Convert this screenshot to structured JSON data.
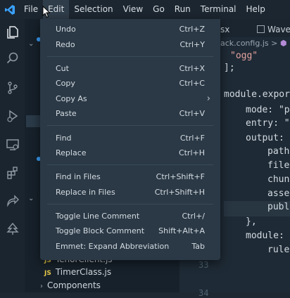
{
  "menubar": {
    "items": [
      {
        "label": "File"
      },
      {
        "label": "Edit"
      },
      {
        "label": "Selection"
      },
      {
        "label": "View"
      },
      {
        "label": "Go"
      },
      {
        "label": "Run"
      },
      {
        "label": "Terminal"
      },
      {
        "label": "Help"
      }
    ]
  },
  "edit_menu": {
    "items": [
      {
        "label": "Undo",
        "shortcut": "Ctrl+Z"
      },
      {
        "label": "Redo",
        "shortcut": "Ctrl+Y"
      },
      {
        "label": "Cut",
        "shortcut": "Ctrl+X"
      },
      {
        "label": "Copy",
        "shortcut": "Ctrl+C"
      },
      {
        "label": "Copy As",
        "shortcut": ""
      },
      {
        "label": "Paste",
        "shortcut": "Ctrl+V"
      },
      {
        "label": "Find",
        "shortcut": "Ctrl+F"
      },
      {
        "label": "Replace",
        "shortcut": "Ctrl+H"
      },
      {
        "label": "Find in Files",
        "shortcut": "Ctrl+Shift+F"
      },
      {
        "label": "Replace in Files",
        "shortcut": "Ctrl+Shift+H"
      },
      {
        "label": "Toggle Line Comment",
        "shortcut": "Ctrl+/"
      },
      {
        "label": "Toggle Block Comment",
        "shortcut": "Shift+Alt+A"
      },
      {
        "label": "Emmet: Expand Abbreviation",
        "shortcut": "Tab"
      }
    ]
  },
  "tabs": [
    {
      "label": "sx"
    },
    {
      "label": "Wave.s"
    }
  ],
  "breadcrumb": {
    "file": "ack.config.js",
    "sep": ">"
  },
  "code": {
    "lines": [
      "\"ogg\"",
      "];",
      "module.expor",
      "mode: \"p",
      "entry: \"",
      "output: {",
      "path",
      "file",
      "chun",
      "asse",
      "publ",
      "},",
      "module:",
      "rule"
    ]
  },
  "line_numbers": [
    "33",
    "34"
  ],
  "sidebar": {
    "files": [
      {
        "badge": "JS",
        "name": "TenorClient.js"
      },
      {
        "badge": "JS",
        "name": "TimerClass.js"
      }
    ],
    "folder": "Components"
  },
  "colors": {
    "accent": "#3aa2ff",
    "menu_bg": "#2b3946"
  }
}
